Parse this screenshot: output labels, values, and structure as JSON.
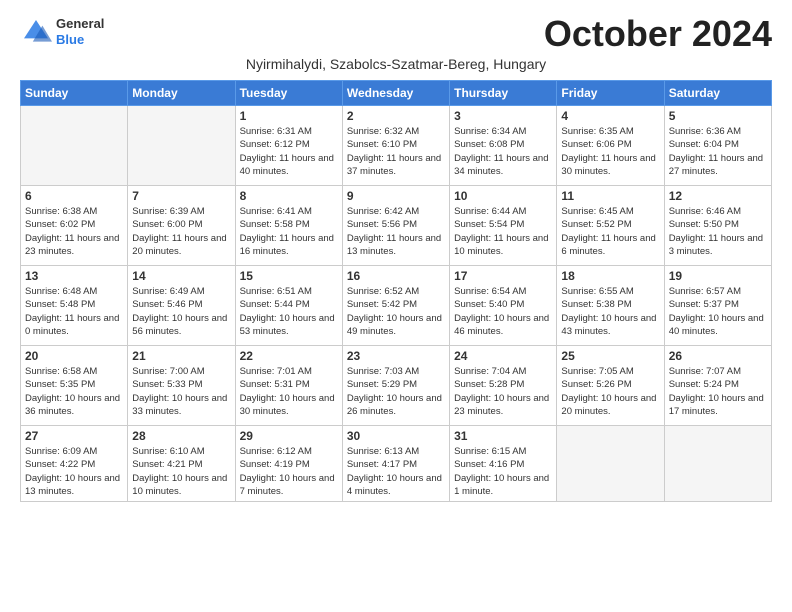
{
  "header": {
    "logo_general": "General",
    "logo_blue": "Blue",
    "month": "October 2024",
    "subtitle": "Nyirmihalydi, Szabolcs-Szatmar-Bereg, Hungary"
  },
  "weekdays": [
    "Sunday",
    "Monday",
    "Tuesday",
    "Wednesday",
    "Thursday",
    "Friday",
    "Saturday"
  ],
  "weeks": [
    [
      {
        "day": "",
        "info": ""
      },
      {
        "day": "",
        "info": ""
      },
      {
        "day": "1",
        "info": "Sunrise: 6:31 AM\nSunset: 6:12 PM\nDaylight: 11 hours and 40 minutes."
      },
      {
        "day": "2",
        "info": "Sunrise: 6:32 AM\nSunset: 6:10 PM\nDaylight: 11 hours and 37 minutes."
      },
      {
        "day": "3",
        "info": "Sunrise: 6:34 AM\nSunset: 6:08 PM\nDaylight: 11 hours and 34 minutes."
      },
      {
        "day": "4",
        "info": "Sunrise: 6:35 AM\nSunset: 6:06 PM\nDaylight: 11 hours and 30 minutes."
      },
      {
        "day": "5",
        "info": "Sunrise: 6:36 AM\nSunset: 6:04 PM\nDaylight: 11 hours and 27 minutes."
      }
    ],
    [
      {
        "day": "6",
        "info": "Sunrise: 6:38 AM\nSunset: 6:02 PM\nDaylight: 11 hours and 23 minutes."
      },
      {
        "day": "7",
        "info": "Sunrise: 6:39 AM\nSunset: 6:00 PM\nDaylight: 11 hours and 20 minutes."
      },
      {
        "day": "8",
        "info": "Sunrise: 6:41 AM\nSunset: 5:58 PM\nDaylight: 11 hours and 16 minutes."
      },
      {
        "day": "9",
        "info": "Sunrise: 6:42 AM\nSunset: 5:56 PM\nDaylight: 11 hours and 13 minutes."
      },
      {
        "day": "10",
        "info": "Sunrise: 6:44 AM\nSunset: 5:54 PM\nDaylight: 11 hours and 10 minutes."
      },
      {
        "day": "11",
        "info": "Sunrise: 6:45 AM\nSunset: 5:52 PM\nDaylight: 11 hours and 6 minutes."
      },
      {
        "day": "12",
        "info": "Sunrise: 6:46 AM\nSunset: 5:50 PM\nDaylight: 11 hours and 3 minutes."
      }
    ],
    [
      {
        "day": "13",
        "info": "Sunrise: 6:48 AM\nSunset: 5:48 PM\nDaylight: 11 hours and 0 minutes."
      },
      {
        "day": "14",
        "info": "Sunrise: 6:49 AM\nSunset: 5:46 PM\nDaylight: 10 hours and 56 minutes."
      },
      {
        "day": "15",
        "info": "Sunrise: 6:51 AM\nSunset: 5:44 PM\nDaylight: 10 hours and 53 minutes."
      },
      {
        "day": "16",
        "info": "Sunrise: 6:52 AM\nSunset: 5:42 PM\nDaylight: 10 hours and 49 minutes."
      },
      {
        "day": "17",
        "info": "Sunrise: 6:54 AM\nSunset: 5:40 PM\nDaylight: 10 hours and 46 minutes."
      },
      {
        "day": "18",
        "info": "Sunrise: 6:55 AM\nSunset: 5:38 PM\nDaylight: 10 hours and 43 minutes."
      },
      {
        "day": "19",
        "info": "Sunrise: 6:57 AM\nSunset: 5:37 PM\nDaylight: 10 hours and 40 minutes."
      }
    ],
    [
      {
        "day": "20",
        "info": "Sunrise: 6:58 AM\nSunset: 5:35 PM\nDaylight: 10 hours and 36 minutes."
      },
      {
        "day": "21",
        "info": "Sunrise: 7:00 AM\nSunset: 5:33 PM\nDaylight: 10 hours and 33 minutes."
      },
      {
        "day": "22",
        "info": "Sunrise: 7:01 AM\nSunset: 5:31 PM\nDaylight: 10 hours and 30 minutes."
      },
      {
        "day": "23",
        "info": "Sunrise: 7:03 AM\nSunset: 5:29 PM\nDaylight: 10 hours and 26 minutes."
      },
      {
        "day": "24",
        "info": "Sunrise: 7:04 AM\nSunset: 5:28 PM\nDaylight: 10 hours and 23 minutes."
      },
      {
        "day": "25",
        "info": "Sunrise: 7:05 AM\nSunset: 5:26 PM\nDaylight: 10 hours and 20 minutes."
      },
      {
        "day": "26",
        "info": "Sunrise: 7:07 AM\nSunset: 5:24 PM\nDaylight: 10 hours and 17 minutes."
      }
    ],
    [
      {
        "day": "27",
        "info": "Sunrise: 6:09 AM\nSunset: 4:22 PM\nDaylight: 10 hours and 13 minutes."
      },
      {
        "day": "28",
        "info": "Sunrise: 6:10 AM\nSunset: 4:21 PM\nDaylight: 10 hours and 10 minutes."
      },
      {
        "day": "29",
        "info": "Sunrise: 6:12 AM\nSunset: 4:19 PM\nDaylight: 10 hours and 7 minutes."
      },
      {
        "day": "30",
        "info": "Sunrise: 6:13 AM\nSunset: 4:17 PM\nDaylight: 10 hours and 4 minutes."
      },
      {
        "day": "31",
        "info": "Sunrise: 6:15 AM\nSunset: 4:16 PM\nDaylight: 10 hours and 1 minute."
      },
      {
        "day": "",
        "info": ""
      },
      {
        "day": "",
        "info": ""
      }
    ]
  ]
}
